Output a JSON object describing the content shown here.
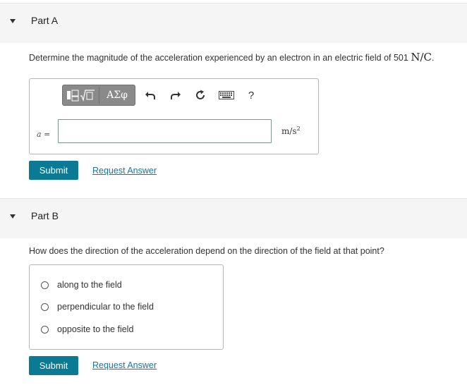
{
  "partA": {
    "title": "Part A",
    "question": "Determine the magnitude of the acceleration experienced by an electron in an electric field of 501",
    "question_unit": "N/C",
    "question_end": ".",
    "toolbar": {
      "templates_icon": "templates-icon",
      "greek_label": "ΑΣφ",
      "undo_icon": "undo-icon",
      "redo_icon": "redo-icon",
      "reset_icon": "reset-icon",
      "keyboard_icon": "keyboard-icon",
      "help_label": "?"
    },
    "variable_label": "a =",
    "answer_value": "",
    "unit_base": "m/s",
    "unit_exp": "2",
    "submit_label": "Submit",
    "request_label": "Request Answer"
  },
  "partB": {
    "title": "Part B",
    "question": "How does the direction of the acceleration depend on the direction of the field at that point?",
    "choices": [
      {
        "label": "along to the field"
      },
      {
        "label": "perpendicular to the field"
      },
      {
        "label": "opposite to the field"
      }
    ],
    "submit_label": "Submit",
    "request_label": "Request Answer"
  }
}
